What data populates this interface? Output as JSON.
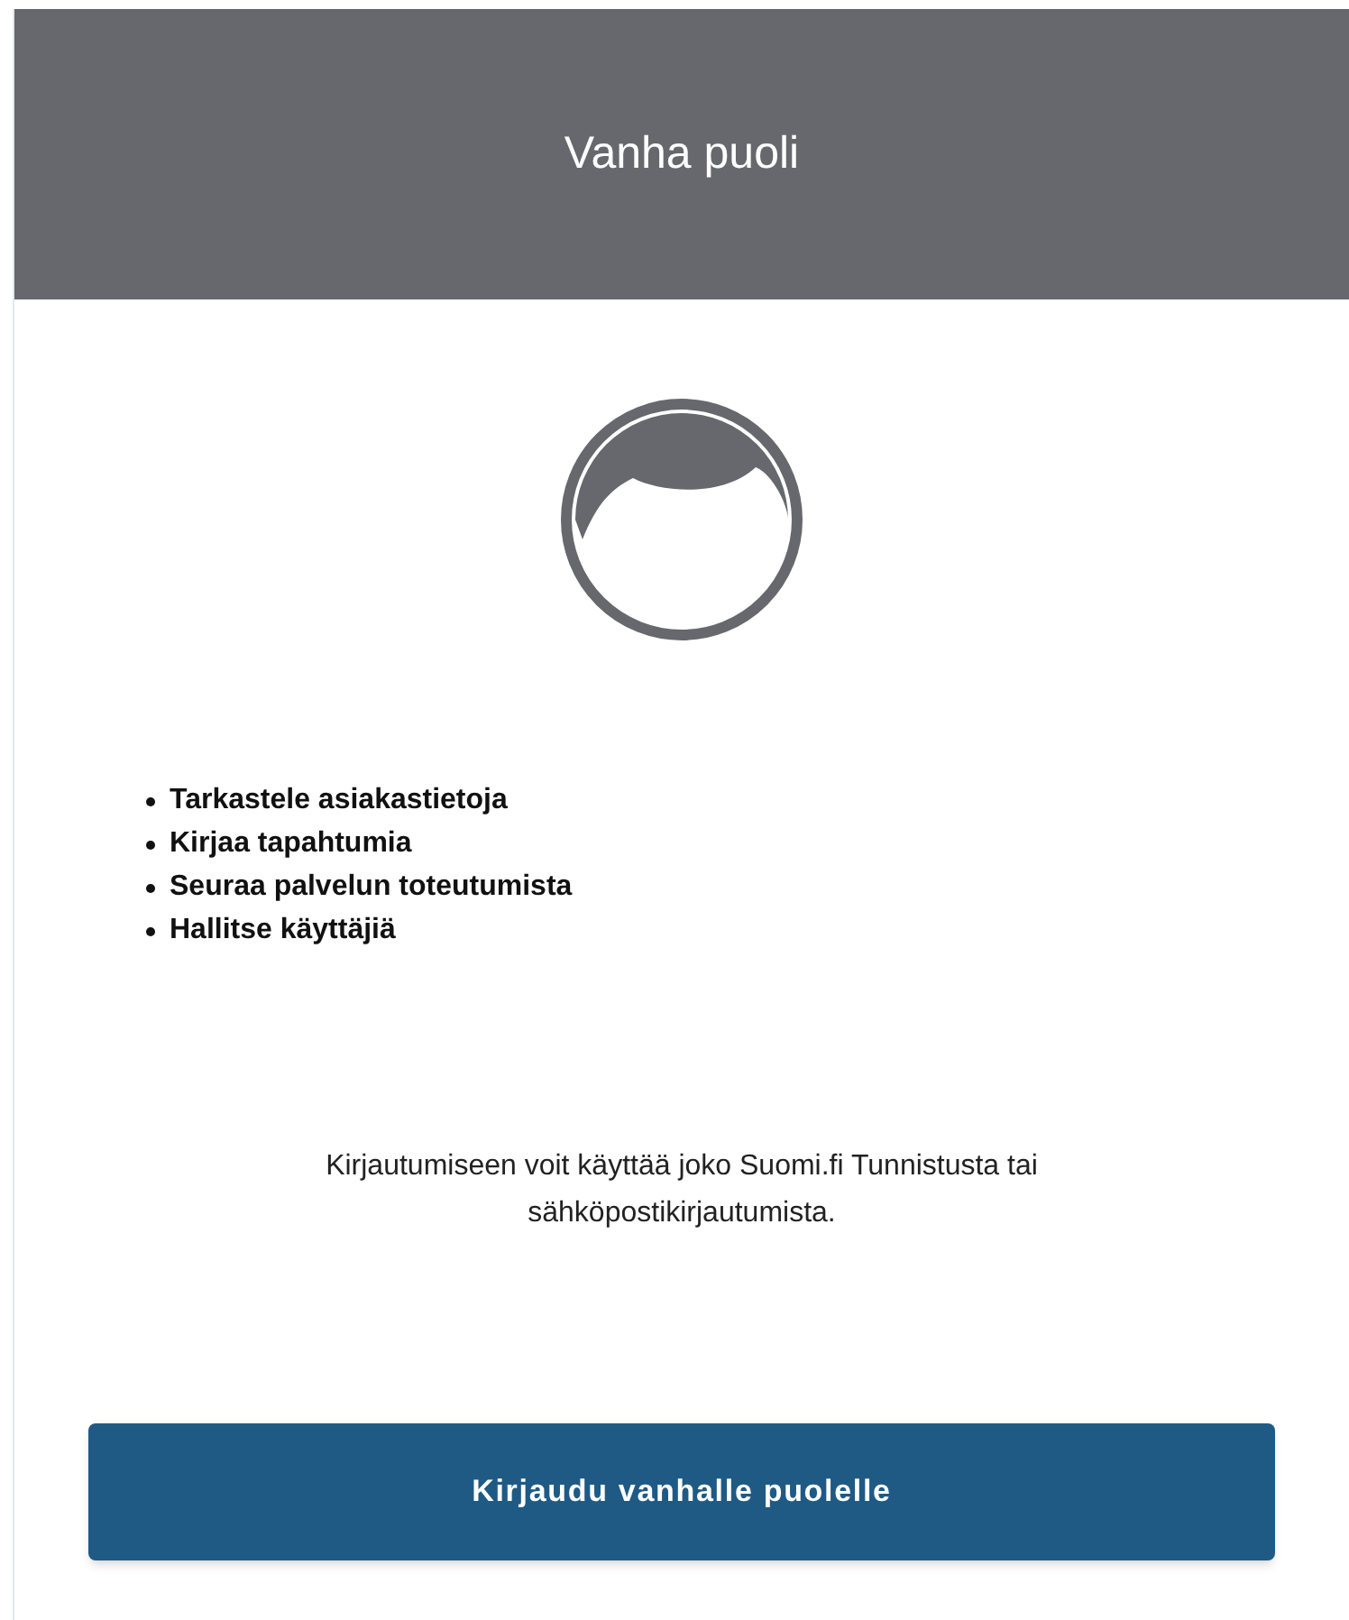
{
  "header": {
    "title": "Vanha puoli"
  },
  "features": [
    "Tarkastele asiakastietoja",
    "Kirjaa tapahtumia",
    "Seuraa palvelun toteutumista",
    "Hallitse käyttäjiä"
  ],
  "info": "Kirjautumiseen voit käyttää joko Suomi.fi Tunnistusta tai sähköpostikirjautumista.",
  "button": {
    "label": "Kirjaudu vanhalle puolelle"
  }
}
